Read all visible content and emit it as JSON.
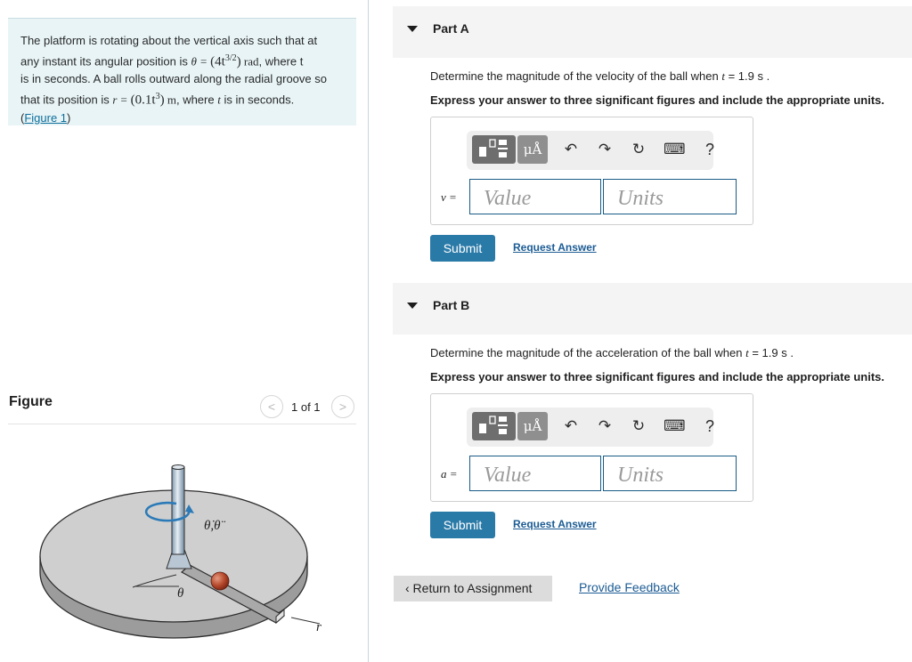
{
  "problem": {
    "line1": "The platform is rotating about the vertical axis such that at",
    "line2_pre": "any instant its angular position is ",
    "theta_lhs": "θ = ",
    "theta_expr": "(4t",
    "theta_exp": "3/2",
    "theta_close": ")",
    "theta_unit": " rad",
    "line2_post": ", where t",
    "line3": "is in seconds. A ball rolls outward along the radial groove so",
    "line4_pre": "that its position is ",
    "r_lhs": "r = ",
    "r_expr": "(0.1t",
    "r_exp": "3",
    "r_close": ")",
    "r_unit": " m",
    "line4_post": ", where ",
    "t_var": "t",
    "line4_end": " is in seconds.",
    "figure_link_open": "(",
    "figure_link": "Figure 1",
    "figure_link_close": ")"
  },
  "figure_panel": {
    "title": "Figure",
    "counter": "1 of 1",
    "prev_glyph": "<",
    "next_glyph": ">",
    "label_thetadot": "θ̇,θ̈",
    "label_theta": "θ",
    "label_r": "r"
  },
  "parts": [
    {
      "title": "Part A",
      "question_pre": "Determine the magnitude of the velocity of the ball when ",
      "question_var": "t",
      "question_post": " = 1.9 s .",
      "instruction": "Express your answer to three significant figures and include the appropriate units.",
      "var_label": "v =",
      "value_placeholder": "Value",
      "units_placeholder": "Units",
      "submit": "Submit",
      "request": "Request Answer"
    },
    {
      "title": "Part B",
      "question_pre": "Determine the magnitude of the acceleration of the ball when ",
      "question_var": "t",
      "question_post": " = 1.9 s .",
      "instruction": "Express your answer to three significant figures and include the appropriate units.",
      "var_label": "a =",
      "value_placeholder": "Value",
      "units_placeholder": "Units",
      "submit": "Submit",
      "request": "Request Answer"
    }
  ],
  "toolbar": {
    "units_label": "μÅ",
    "undo_icon": "↶",
    "redo_icon": "↷",
    "reset_icon": "↻",
    "keyboard_icon": "⌨",
    "help_label": "?"
  },
  "footer": {
    "return_label": "‹ Return to Assignment",
    "feedback_label": "Provide Feedback"
  }
}
